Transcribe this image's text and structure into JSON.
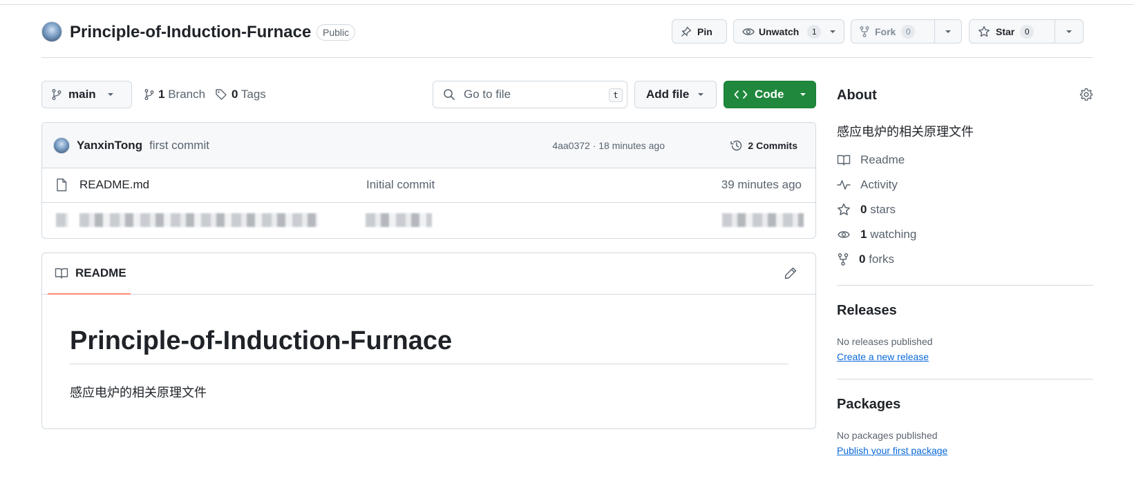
{
  "repo": {
    "name": "Principle-of-Induction-Furnace",
    "visibility": "Public"
  },
  "actions": {
    "pin_label": "Pin",
    "watch_label": "Unwatch",
    "watch_count": "1",
    "fork_label": "Fork",
    "fork_count": "0",
    "star_label": "Star",
    "star_count": "0"
  },
  "toolbar": {
    "branch": "main",
    "branch_count": "1",
    "branch_label": "Branch",
    "tag_count": "0",
    "tag_label": "Tags",
    "search_placeholder": "Go to file",
    "search_shortcut": "t",
    "add_file_label": "Add file",
    "code_label": "Code"
  },
  "latest_commit": {
    "author": "YanxinTong",
    "message": "first commit",
    "meta": "4aa0372 · 18 minutes ago",
    "commits_label": "2 Commits"
  },
  "files": [
    {
      "name": "README.md",
      "message": "Initial commit",
      "date": "39 minutes ago"
    }
  ],
  "readme": {
    "tab_label": "README",
    "heading": "Principle-of-Induction-Furnace",
    "body": "感应电炉的相关原理文件"
  },
  "about": {
    "title": "About",
    "description": "感应电炉的相关原理文件",
    "readme_label": "Readme",
    "activity_label": "Activity",
    "stars_count": "0",
    "stars_label": "stars",
    "watching_count": "1",
    "watching_label": "watching",
    "forks_count": "0",
    "forks_label": "forks"
  },
  "releases": {
    "title": "Releases",
    "empty_text": "No releases published",
    "link": "Create a new release"
  },
  "packages": {
    "title": "Packages",
    "empty_text": "No packages published",
    "link": "Publish your first package"
  },
  "colors": {
    "accent_green": "#1f883d",
    "link_blue": "#0969da",
    "tab_underline": "#fd8c73"
  }
}
